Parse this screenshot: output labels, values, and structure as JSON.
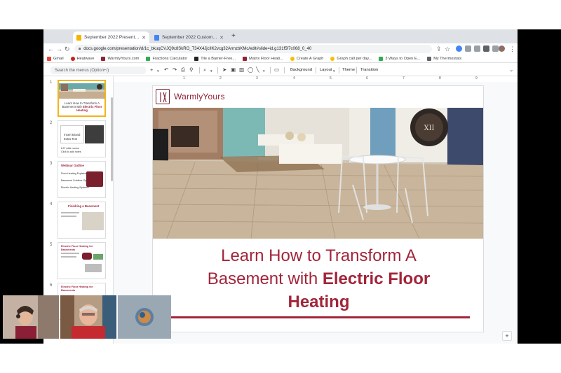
{
  "browser": {
    "tabs": [
      {
        "label": "September 2022 Presentation",
        "color": "#f4b400",
        "active": true
      },
      {
        "label": "September 2022 Customer C...",
        "color": "#4285f4",
        "active": false
      }
    ],
    "url": "docs.google.com/presentation/d/1c_bkuqCVJQ9c8SkRO_T34X4JjclIK2vcg32ArmzbKMc/edit#slide=id.g131f5f7c068_0_40"
  },
  "bookmarks": [
    {
      "label": "Gmail",
      "color": "#ea4335"
    },
    {
      "label": "Heatwave",
      "color": "#c5221f"
    },
    {
      "label": "WarmlyYours.com",
      "color": "#8f2334"
    },
    {
      "label": "Fractions Calculator",
      "color": "#34a853"
    },
    {
      "label": "Tile a Barrier-Free...",
      "color": "#202124"
    },
    {
      "label": "Matrix Floor Heati...",
      "color": "#8f2334"
    },
    {
      "label": "Create A Graph",
      "color": "#fbbc04"
    },
    {
      "label": "Graph call per day...",
      "color": "#fbbc04"
    },
    {
      "label": "3 Ways to Open E...",
      "color": "#34a853"
    },
    {
      "label": "My Thermostats",
      "color": "#5f6368"
    }
  ],
  "toolbar": {
    "search_placeholder": "Search the menus (Option+/)",
    "background": "Background",
    "layout": "Layout",
    "theme": "Theme",
    "transition": "Transition"
  },
  "ruler": [
    "1",
    "2",
    "3",
    "4",
    "5",
    "6",
    "7",
    "8",
    "9"
  ],
  "filmstrip": [
    {
      "num": "1"
    },
    {
      "num": "2",
      "lines": [
        "Insert Brand",
        "Extra Text",
        "8.5\" wide rooms",
        "Click to add notes"
      ]
    },
    {
      "num": "3",
      "title": "Webinar Outline",
      "lines": [
        "Floor Heating Explained",
        "Basement Subfloor Options",
        "Electric Heating Systems"
      ]
    },
    {
      "num": "4",
      "title": "Finishing a Basement"
    },
    {
      "num": "5",
      "title": "Electric Floor Heating for Basements"
    },
    {
      "num": "6",
      "title": "Electric Floor Heating for Basements"
    }
  ],
  "slide": {
    "logo": "WarmlyYours",
    "title_line1": "Learn How to Transform A",
    "title_line2_plain": "Basement with ",
    "title_line2_bold": "Electric Floor",
    "title_line3_bold": "Heating",
    "accent": "#a2253a"
  },
  "thumb1": {
    "line1": "Learn How to Transform A",
    "line2": "Basement with",
    "line2_bold": "Electric Floor",
    "line3_bold": "Heating"
  }
}
